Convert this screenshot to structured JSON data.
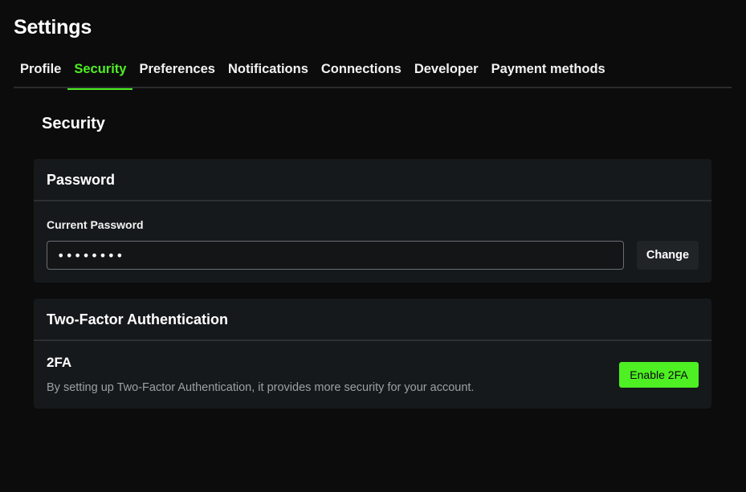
{
  "page": {
    "title": "Settings"
  },
  "tabs": [
    {
      "label": "Profile"
    },
    {
      "label": "Security"
    },
    {
      "label": "Preferences"
    },
    {
      "label": "Notifications"
    },
    {
      "label": "Connections"
    },
    {
      "label": "Developer"
    },
    {
      "label": "Payment methods"
    }
  ],
  "active_tab": "Security",
  "section": {
    "title": "Security"
  },
  "password": {
    "header": "Password",
    "label": "Current Password",
    "value": "••••••••",
    "change_label": "Change"
  },
  "twofa": {
    "header": "Two-Factor Authentication",
    "title": "2FA",
    "description": "By setting up Two-Factor Authentication, it provides more security for your account.",
    "enable_label": "Enable 2FA"
  },
  "colors": {
    "accent": "#4eef23",
    "background": "#0c0c0c",
    "card": "#16191b"
  }
}
